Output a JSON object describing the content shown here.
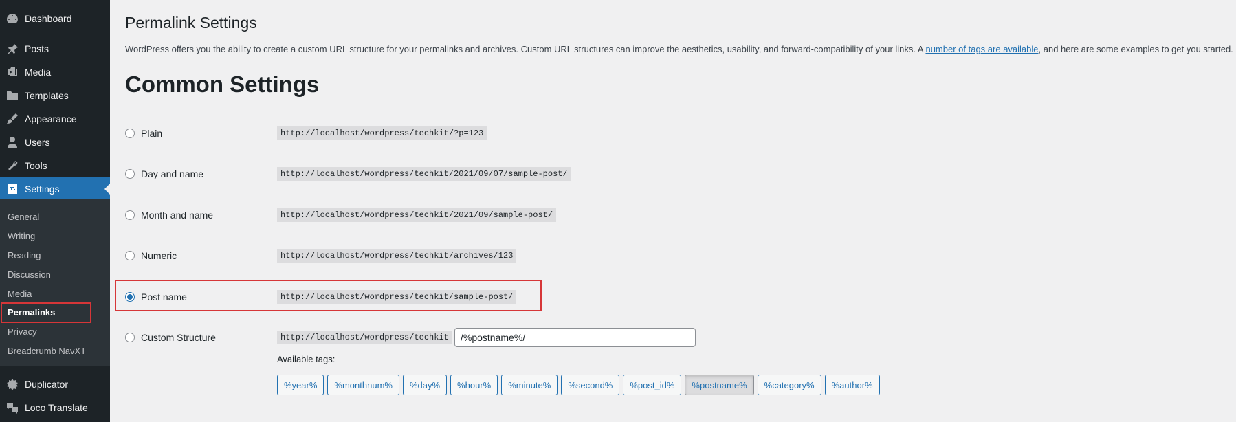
{
  "sidebar": {
    "items": [
      {
        "label": "Dashboard",
        "icon": "dashboard-icon"
      },
      {
        "label": "Posts",
        "icon": "pin-icon"
      },
      {
        "label": "Media",
        "icon": "media-icon"
      },
      {
        "label": "Templates",
        "icon": "folder-icon"
      },
      {
        "label": "Appearance",
        "icon": "brush-icon"
      },
      {
        "label": "Users",
        "icon": "user-icon"
      },
      {
        "label": "Tools",
        "icon": "wrench-icon"
      },
      {
        "label": "Settings",
        "icon": "settings-icon"
      },
      {
        "label": "Duplicator",
        "icon": "duplicator-icon"
      },
      {
        "label": "Loco Translate",
        "icon": "translate-icon"
      }
    ],
    "submenu": [
      "General",
      "Writing",
      "Reading",
      "Discussion",
      "Media",
      "Permalinks",
      "Privacy",
      "Breadcrumb NavXT"
    ]
  },
  "page": {
    "title": "Permalink Settings",
    "intro_before": "WordPress offers you the ability to create a custom URL structure for your permalinks and archives. Custom URL structures can improve the aesthetics, usability, and forward-compatibility of your links. A ",
    "intro_link": "number of tags are available",
    "intro_after": ", and here are some examples to get you started.",
    "section_title": "Common Settings"
  },
  "options": [
    {
      "label": "Plain",
      "example": "http://localhost/wordpress/techkit/?p=123"
    },
    {
      "label": "Day and name",
      "example": "http://localhost/wordpress/techkit/2021/09/07/sample-post/"
    },
    {
      "label": "Month and name",
      "example": "http://localhost/wordpress/techkit/2021/09/sample-post/"
    },
    {
      "label": "Numeric",
      "example": "http://localhost/wordpress/techkit/archives/123"
    },
    {
      "label": "Post name",
      "example": "http://localhost/wordpress/techkit/sample-post/",
      "selected": true
    },
    {
      "label": "Custom Structure",
      "example": "http://localhost/wordpress/techkit"
    }
  ],
  "custom_structure": {
    "value": "/%postname%/"
  },
  "available_tags": {
    "label": "Available tags:",
    "tags": [
      "%year%",
      "%monthnum%",
      "%day%",
      "%hour%",
      "%minute%",
      "%second%",
      "%post_id%",
      "%postname%",
      "%category%",
      "%author%"
    ],
    "pressed": "%postname%"
  },
  "colors": {
    "accent": "#2271b1",
    "sidebar": "#1d2327",
    "highlight": "#d63638"
  }
}
